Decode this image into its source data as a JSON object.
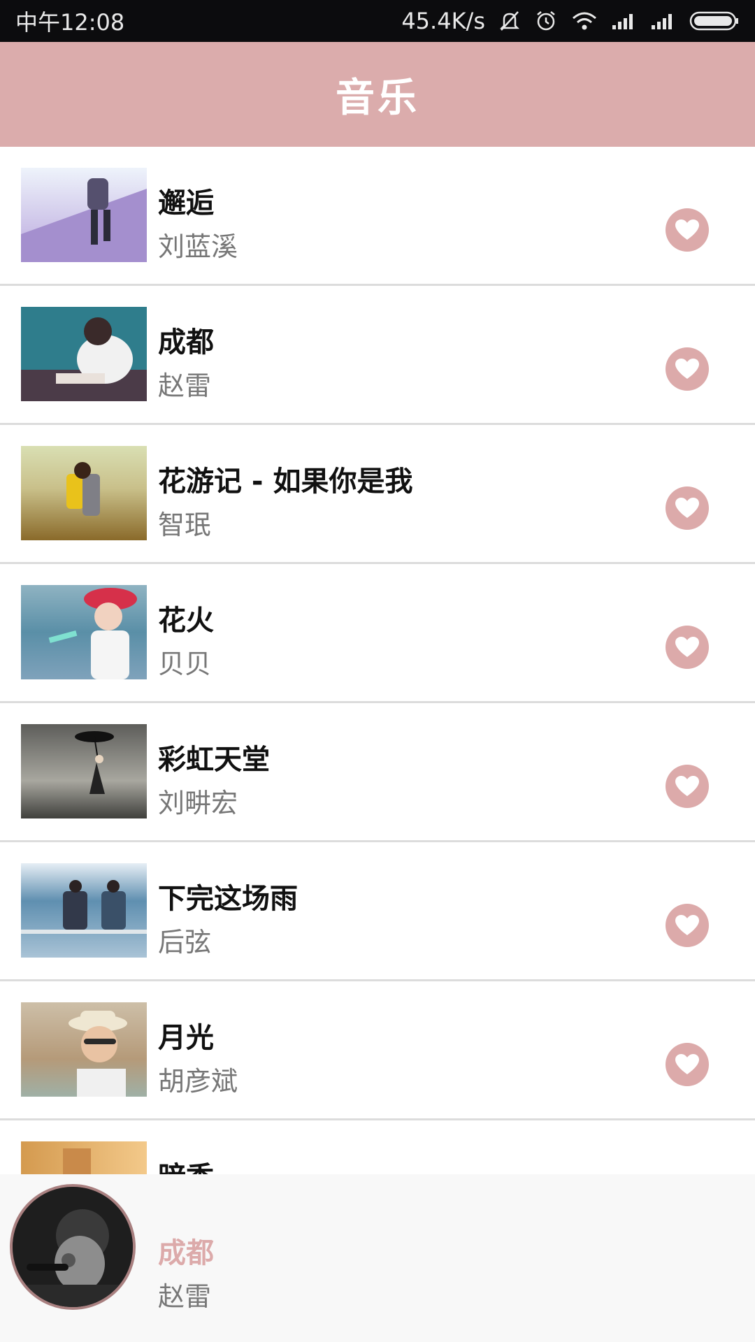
{
  "status_bar": {
    "time": "中午12:08",
    "net_speed": "45.4K/s",
    "icons": [
      "mute-bell-icon",
      "alarm-icon",
      "wifi-icon",
      "signal-icon",
      "signal-icon",
      "battery-icon"
    ]
  },
  "header": {
    "title": "音乐"
  },
  "colors": {
    "accent": "#dbacac",
    "heart": "#dcaaaa",
    "status_bg": "#0c0c0e"
  },
  "songs": [
    {
      "title": "邂逅",
      "artist": "刘蓝溪"
    },
    {
      "title": "成都",
      "artist": "赵雷"
    },
    {
      "title": "花游记 - 如果你是我",
      "artist": "智珉"
    },
    {
      "title": "花火",
      "artist": "贝贝"
    },
    {
      "title": "彩虹天堂",
      "artist": "刘畊宏"
    },
    {
      "title": "下完这场雨",
      "artist": "后弦"
    },
    {
      "title": "月光",
      "artist": "胡彦斌"
    },
    {
      "title": "暗香",
      "artist": ""
    }
  ],
  "now_playing": {
    "title": "成都",
    "artist": "赵雷"
  }
}
